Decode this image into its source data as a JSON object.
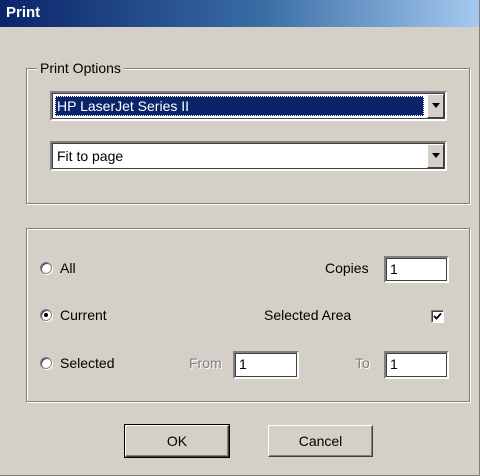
{
  "window": {
    "title": "Print"
  },
  "print_options": {
    "legend": "Print Options",
    "printer": {
      "value": "HP LaserJet Series II",
      "icon": "chevron-down-icon"
    },
    "scaling": {
      "value": "Fit to page",
      "icon": "chevron-down-icon"
    }
  },
  "range": {
    "all_label": "All",
    "current_label": "Current",
    "selected_label": "Selected",
    "selected_option": "Current",
    "copies_label": "Copies",
    "copies_value": "1",
    "selected_area_label": "Selected Area",
    "selected_area_checked": true,
    "from_label": "From",
    "from_value": "1",
    "to_label": "To",
    "to_value": "1"
  },
  "buttons": {
    "ok_label": "OK",
    "cancel_label": "Cancel"
  },
  "colors": {
    "title_bar_start": "#0a246a",
    "title_bar_end": "#a6caf0",
    "dialog_face": "#d4d0c8",
    "selection": "#0a246a"
  }
}
